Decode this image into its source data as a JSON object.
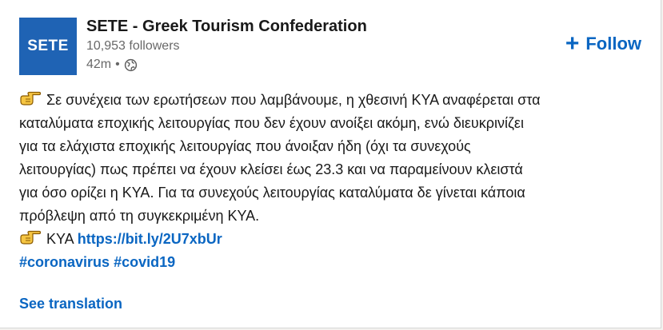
{
  "company": {
    "logo_text": "SETE",
    "name": "SETE - Greek Tourism Confederation",
    "followers": "10,953 followers",
    "time": "42m",
    "separator": "•",
    "visibility_icon": "globe-icon"
  },
  "follow_button": {
    "plus": "+",
    "label": "Follow"
  },
  "post": {
    "lines": [
      "Σε συνέχεια των ερωτήσεων που λαμβάνουμε, η χθεσινή ΚΥΑ αναφέρεται στα",
      "καταλύματα εποχικής λειτουργίας που δεν έχουν ανοίξει ακόμη, ενώ διευκρινίζει",
      "για τα ελάχιστα εποχικής λειτουργίας που άνοιξαν ήδη (όχι τα συνεχούς",
      "λειτουργίας) πως πρέπει να έχουν κλείσει έως 23.3 και να παραμείνουν κλειστά",
      "για όσο ορίζει η ΚΥΑ. Για τα συνεχούς λειτουργίας καταλύματα δε γίνεται κάποια",
      "πρόβλεψη από τη συγκεκριμένη ΚΥΑ."
    ],
    "link_prefix": "ΚΥΑ",
    "link_url": "https://bit.ly/2U7xbUr",
    "hashtags": [
      "#coronavirus",
      "#covid19"
    ],
    "pointing_icon": "backhand-index-pointing-right-icon"
  },
  "see_translation": "See translation",
  "colors": {
    "brand_blue": "#0a66c2",
    "logo_blue": "#1f63b4"
  }
}
